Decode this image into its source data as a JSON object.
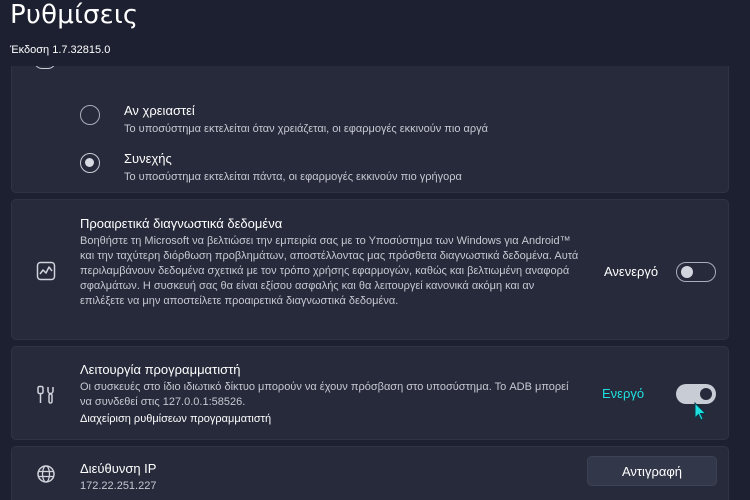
{
  "header": {
    "title": "Ρυθμίσεις",
    "version": "Έκδοση 1.7.32815.0"
  },
  "resources": {
    "options": [
      {
        "title": "Αν χρειαστεί",
        "desc": "Το υποσύστημα εκτελείται όταν χρειάζεται, οι εφαρμογές εκκινούν πιο αργά",
        "selected": false
      },
      {
        "title": "Συνεχής",
        "desc": "Το υποσύστημα εκτελείται πάντα, οι εφαρμογές εκκινούν πιο γρήγορα",
        "selected": true
      }
    ]
  },
  "diagnostics": {
    "icon": "diagnostics-chart-icon",
    "title": "Προαιρετικά διαγνωστικά δεδομένα",
    "desc": "Βοηθήστε τη Microsoft να βελτιώσει την εμπειρία σας με το Υποσύστημα των Windows για Android™ και την ταχύτερη διόρθωση προβλημάτων, αποστέλλοντας μας πρόσθετα διαγνωστικά δεδομένα. Αυτά περιλαμβάνουν δεδομένα σχετικά με τον τρόπο χρήσης εφαρμογών, καθώς και βελτιωμένη αναφορά σφαλμάτων. Η συσκευή σας θα είναι εξίσου ασφαλής και θα λειτουργεί κανονικά ακόμη και αν επιλέξετε να μην αποστείλετε προαιρετικά διαγνωστικά δεδομένα.",
    "state_label": "Ανενεργό",
    "state": false
  },
  "developer": {
    "icon": "developer-tools-icon",
    "title": "Λειτουργία προγραμματιστή",
    "desc": "Οι συσκευές στο ίδιο ιδιωτικό δίκτυο μπορούν να έχουν πρόσβαση στο υποσύστημα. Το ADB μπορεί να συνδεθεί στις 127.0.0.1:58526.",
    "link": "Διαχείριση ρυθμίσεων προγραμματιστή",
    "state_label": "Ενεργό",
    "state": true
  },
  "ip": {
    "icon": "globe-icon",
    "title": "Διεύθυνση IP",
    "value": "172.22.251.227",
    "copy_label": "Αντιγραφή"
  },
  "colors": {
    "background": "#1c2030",
    "card": "#262a3a",
    "highlight": "#1fe0e0"
  }
}
